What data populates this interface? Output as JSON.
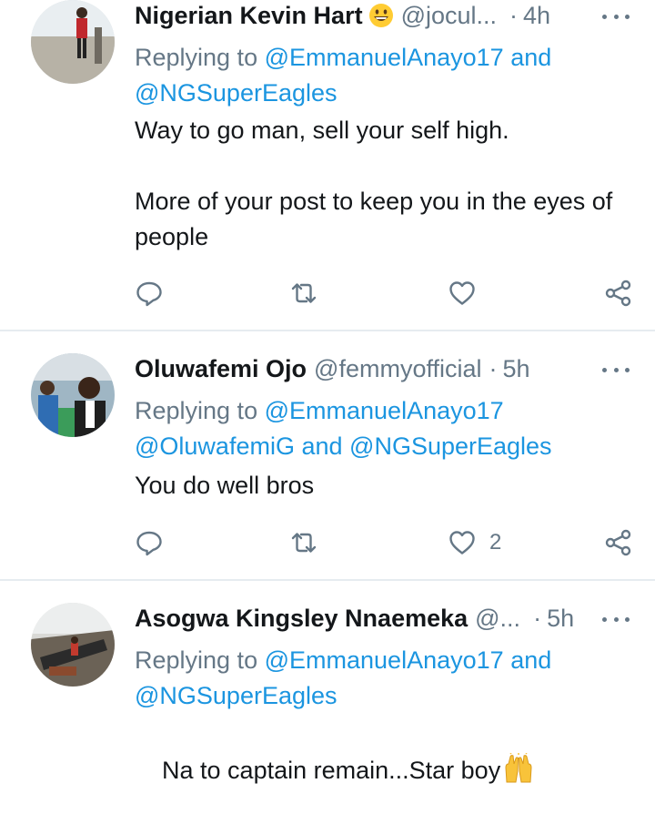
{
  "tweets": [
    {
      "name": "Nigerian Kevin Hart",
      "handle": "@jocul...",
      "dot": "·",
      "time": "4h",
      "reply_prefix": "Replying to",
      "mentions": [
        "@EmmanuelAnayo17",
        "and",
        "@NGSuperEagles"
      ],
      "body": "Way to go man, sell your self high.\n\nMore of your post to keep you in the eyes of people",
      "like_count": ""
    },
    {
      "name": "Oluwafemi Ojo",
      "handle": "@femmyofficial",
      "dot": "·",
      "time": "5h",
      "reply_prefix": "Replying to",
      "mentions": [
        "@EmmanuelAnayo17",
        "@OluwafemiG",
        "and",
        "@NGSuperEagles"
      ],
      "body": "You do well bros",
      "like_count": "2"
    },
    {
      "name": "Asogwa Kingsley Nnaemeka",
      "handle": "@...",
      "dot": "·",
      "time": "5h",
      "reply_prefix": "Replying to",
      "mentions": [
        "@EmmanuelAnayo17",
        "and",
        "@NGSuperEagles"
      ],
      "body": "Na to captain remain...Star boy",
      "like_count": ""
    }
  ],
  "icons": {
    "reply": "reply-icon",
    "retweet": "retweet-icon",
    "like": "heart-icon",
    "share": "share-icon",
    "more": "more-icon"
  },
  "colors": {
    "accent": "#1b95e0",
    "secondary": "#657786",
    "divider": "#e6ecf0"
  }
}
